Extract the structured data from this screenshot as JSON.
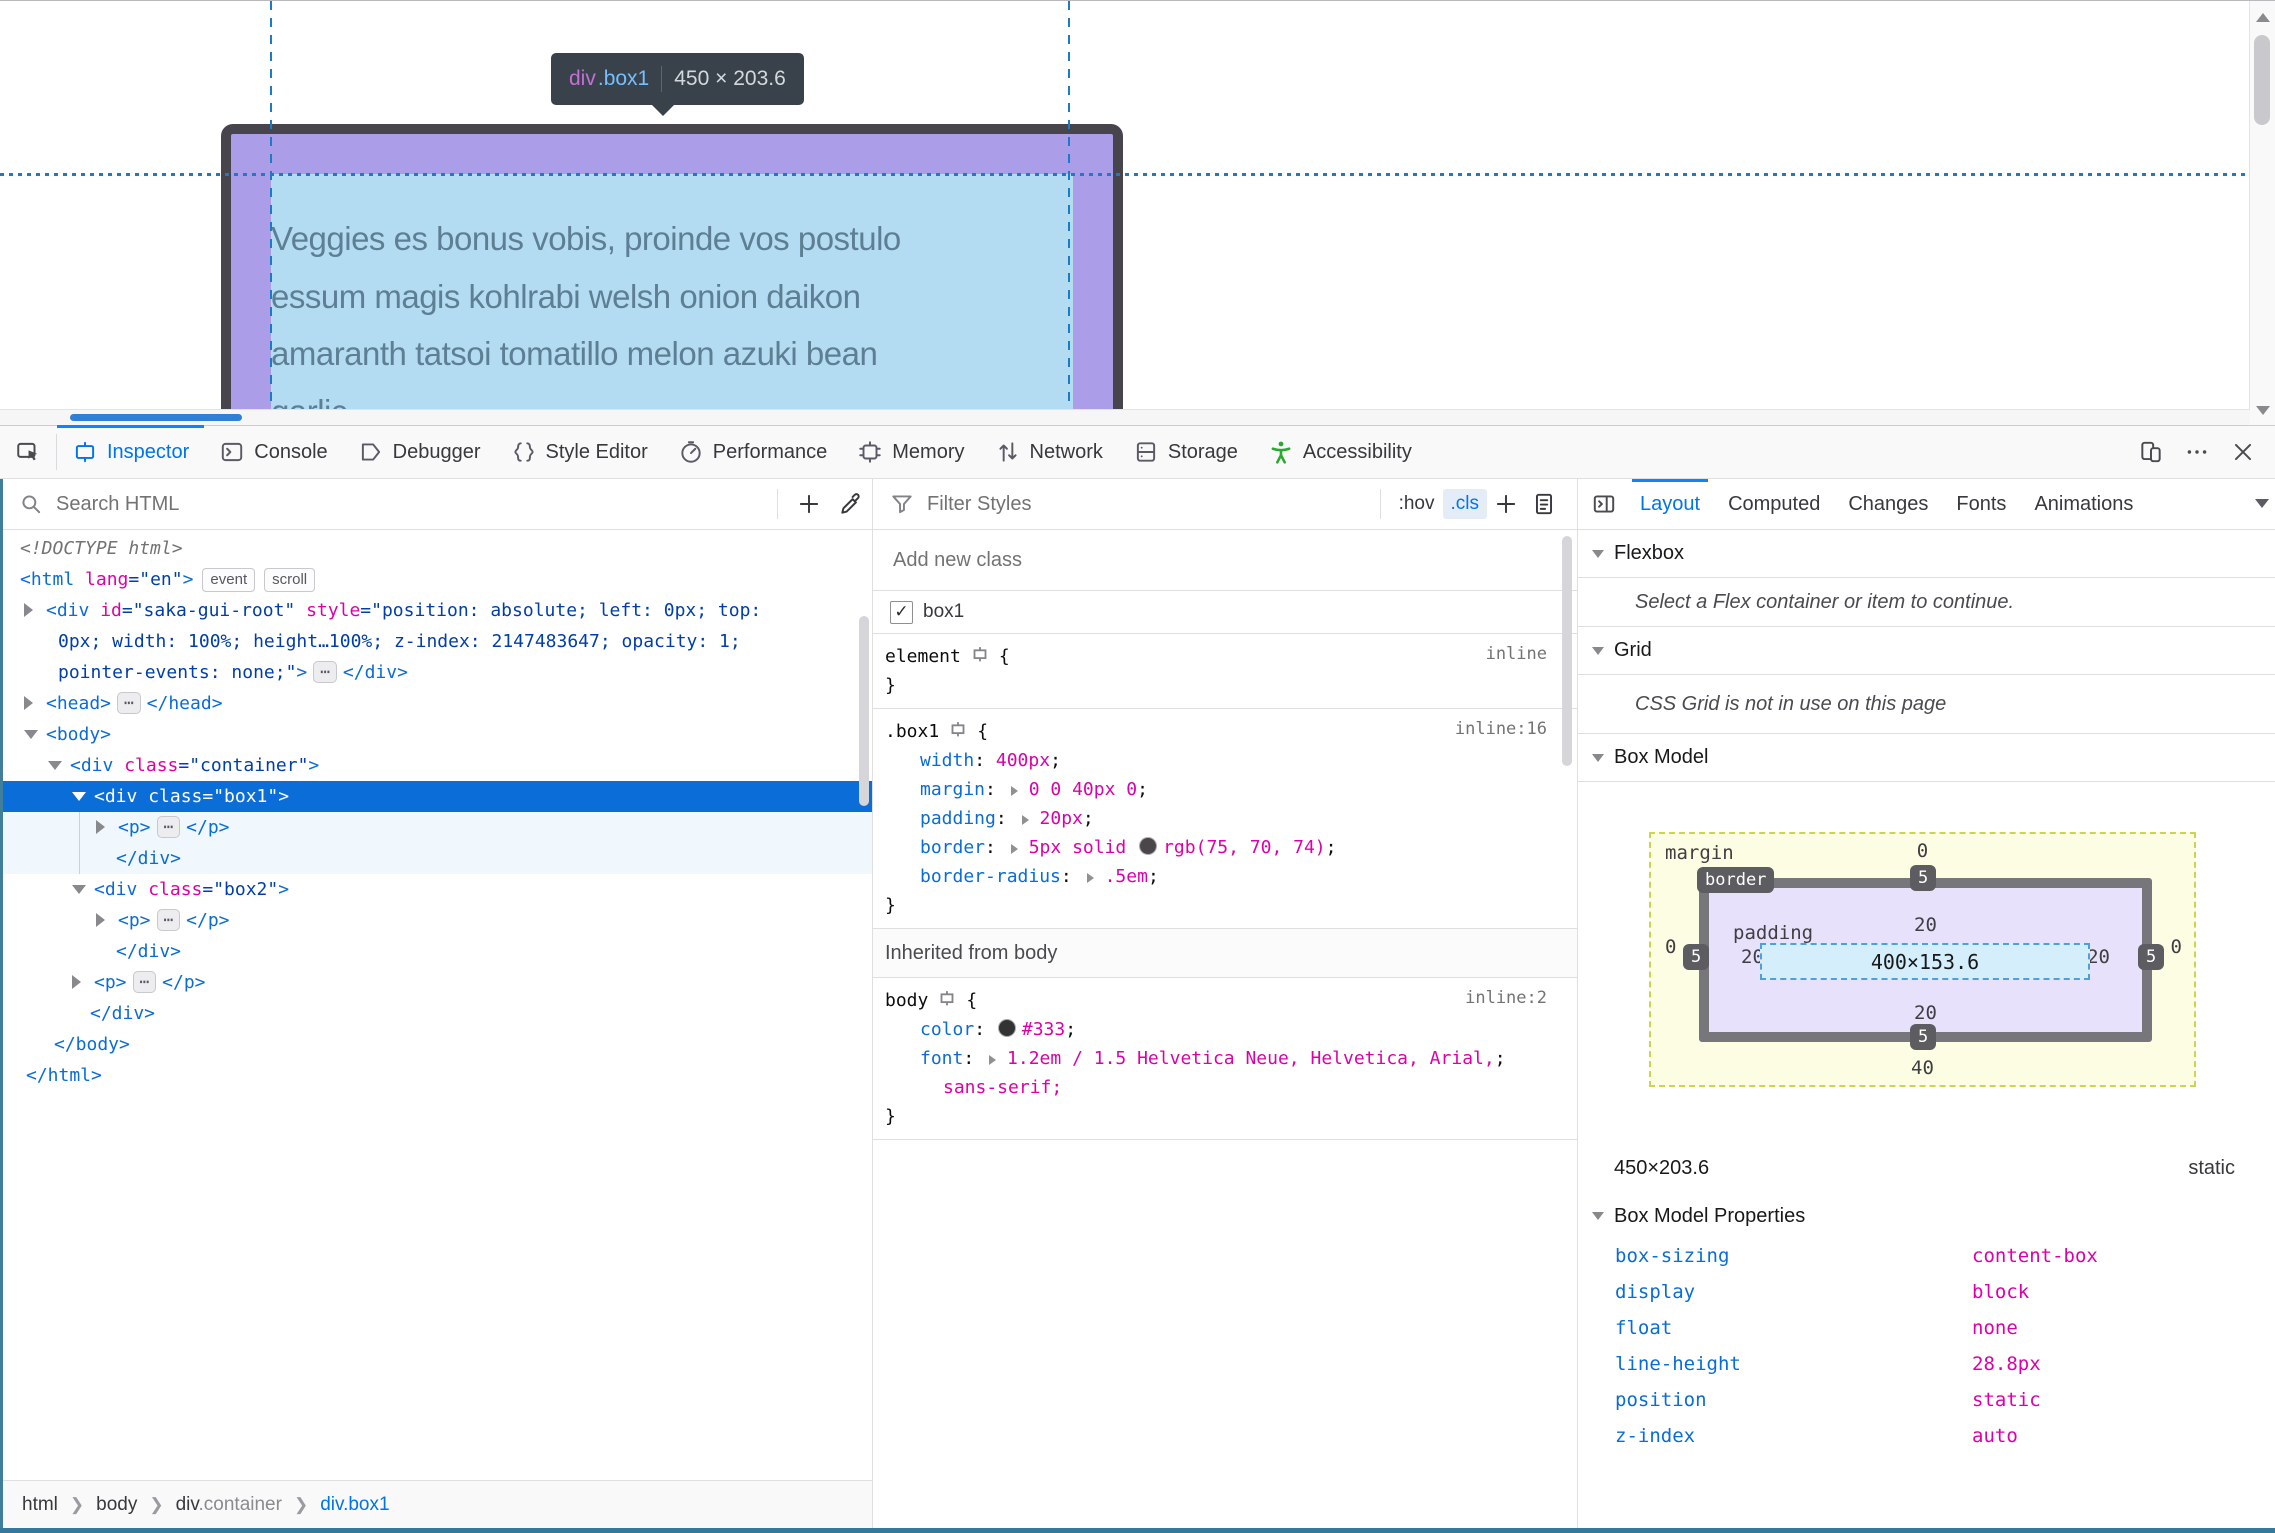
{
  "viewport": {
    "tooltip": {
      "tag": "div",
      "class": ".box1",
      "size": "450 × 203.6"
    },
    "page_text_lines": [
      "Veggies es bonus vobis, proinde vos postulo",
      "essum magis kohlrabi welsh onion daikon",
      "amaranth tatsoi tomatillo melon azuki bean",
      "garlic."
    ],
    "overlay_colors": {
      "border": "#47444b",
      "padding": "#ab9de8",
      "content": "#b3dcf2",
      "guide": "#1d7ac4"
    }
  },
  "toolbar": {
    "tabs": [
      {
        "icon": "inspector",
        "label": "Inspector",
        "active": true
      },
      {
        "icon": "console",
        "label": "Console"
      },
      {
        "icon": "debugger",
        "label": "Debugger"
      },
      {
        "icon": "style-editor",
        "label": "Style Editor"
      },
      {
        "icon": "performance",
        "label": "Performance"
      },
      {
        "icon": "memory",
        "label": "Memory"
      },
      {
        "icon": "network",
        "label": "Network"
      },
      {
        "icon": "storage",
        "label": "Storage"
      },
      {
        "icon": "accessibility",
        "label": "Accessibility",
        "green": true
      }
    ],
    "right_icons": [
      "responsive-mode",
      "meatball-menu",
      "close"
    ]
  },
  "markup": {
    "search_placeholder": "Search HTML",
    "rows": [
      {
        "indent": 20,
        "parts": [
          {
            "c": "doctype",
            "x": "<!DOCTYPE html>"
          }
        ]
      },
      {
        "indent": 20,
        "parts": [
          {
            "c": "tag",
            "x": "<html "
          },
          {
            "c": "attr",
            "x": "lang"
          },
          {
            "c": "val",
            "x": "=\"en\""
          },
          {
            "c": "tag",
            "x": ">"
          },
          {
            "badge": "event"
          },
          {
            "badge": "scroll"
          }
        ]
      },
      {
        "indent": 46,
        "arrow": "right",
        "parts": [
          {
            "c": "tag",
            "x": "<div "
          },
          {
            "c": "attr",
            "x": "id"
          },
          {
            "c": "val",
            "x": "=\"saka-gui-root\" "
          },
          {
            "c": "attr",
            "x": "style"
          },
          {
            "c": "val",
            "x": "=\"position: absolute; left: 0px; top:"
          }
        ]
      },
      {
        "indent": 58,
        "parts": [
          {
            "c": "val",
            "x": "0px; width: 100%; height…100%; z-index: 2147483647; opacity: 1;"
          }
        ]
      },
      {
        "indent": 58,
        "parts": [
          {
            "c": "val",
            "x": "pointer-events: none;\""
          },
          {
            "c": "tag",
            "x": ">"
          },
          {
            "ellipsis": true
          },
          {
            "c": "tag",
            "x": "</div>"
          }
        ]
      },
      {
        "indent": 46,
        "arrow": "right",
        "parts": [
          {
            "c": "tag",
            "x": "<head>"
          },
          {
            "ellipsis": true
          },
          {
            "c": "tag",
            "x": "</head>"
          }
        ]
      },
      {
        "indent": 46,
        "arrow": "down",
        "parts": [
          {
            "c": "tag",
            "x": "<body>"
          }
        ]
      },
      {
        "indent": 70,
        "arrow": "down",
        "parts": [
          {
            "c": "tag",
            "x": "<div "
          },
          {
            "c": "attr",
            "x": "class"
          },
          {
            "c": "val",
            "x": "=\"container\""
          },
          {
            "c": "tag",
            "x": ">"
          }
        ]
      },
      {
        "indent": 94,
        "arrow": "down",
        "selected": true,
        "parts": [
          {
            "c": "tag",
            "x": "<div "
          },
          {
            "c": "attr",
            "x": "class"
          },
          {
            "c": "val",
            "x": "=\"box1\""
          },
          {
            "c": "tag",
            "x": ">"
          }
        ]
      },
      {
        "indent": 118,
        "arrow": "right",
        "tinted": true,
        "parts": [
          {
            "c": "tag",
            "x": "<p>"
          },
          {
            "ellipsis": true
          },
          {
            "c": "tag",
            "x": "</p>"
          }
        ]
      },
      {
        "indent": 116,
        "tinted": true,
        "parts": [
          {
            "c": "tag",
            "x": "</div>"
          }
        ]
      },
      {
        "indent": 94,
        "arrow": "down",
        "parts": [
          {
            "c": "tag",
            "x": "<div "
          },
          {
            "c": "attr",
            "x": "class"
          },
          {
            "c": "val",
            "x": "=\"box2\""
          },
          {
            "c": "tag",
            "x": ">"
          }
        ]
      },
      {
        "indent": 118,
        "arrow": "right",
        "parts": [
          {
            "c": "tag",
            "x": "<p>"
          },
          {
            "ellipsis": true
          },
          {
            "c": "tag",
            "x": "</p>"
          }
        ]
      },
      {
        "indent": 116,
        "parts": [
          {
            "c": "tag",
            "x": "</div>"
          }
        ]
      },
      {
        "indent": 94,
        "arrow": "right",
        "parts": [
          {
            "c": "tag",
            "x": "<p>"
          },
          {
            "ellipsis": true
          },
          {
            "c": "tag",
            "x": "</p>"
          }
        ]
      },
      {
        "indent": 90,
        "parts": [
          {
            "c": "tag",
            "x": "</div>"
          }
        ]
      },
      {
        "indent": 54,
        "parts": [
          {
            "c": "tag",
            "x": "</body>"
          }
        ]
      },
      {
        "indent": 26,
        "parts": [
          {
            "c": "tag",
            "x": "</html>"
          }
        ]
      }
    ]
  },
  "rules": {
    "filter_placeholder": "Filter Styles",
    "hov_label": ":hov",
    "cls_label": ".cls",
    "add_class_placeholder": "Add new class",
    "class_items": [
      {
        "label": "box1",
        "checked": true
      }
    ],
    "rule_blocks": [
      {
        "selector": "element",
        "link": "inline",
        "decls": []
      },
      {
        "selector": ".box1",
        "link": "inline:16",
        "decls": [
          {
            "name": "width",
            "value": "400px"
          },
          {
            "name": "margin",
            "expand": true,
            "value": "0 0 40px 0"
          },
          {
            "name": "padding",
            "expand": true,
            "value": "20px"
          },
          {
            "name": "border",
            "expand": true,
            "pre": "5px solid ",
            "swatch": "#4b464a",
            "value": "rgb(75, 70, 74)"
          },
          {
            "name": "border-radius",
            "expand": true,
            "value": ".5em"
          }
        ]
      }
    ],
    "inherited_header": "Inherited from body",
    "inherited_rule": {
      "selector": "body",
      "link": "inline:2",
      "decls": [
        {
          "name": "color",
          "swatch": "#333333",
          "value": "#333"
        },
        {
          "name": "font",
          "expand": true,
          "value": "1.2em / 1.5 Helvetica Neue, Helvetica, Arial,",
          "wrap": "sans-serif;"
        }
      ]
    }
  },
  "layout_panel": {
    "tabs": [
      {
        "label": "Layout",
        "active": true
      },
      {
        "label": "Computed"
      },
      {
        "label": "Changes"
      },
      {
        "label": "Fonts"
      },
      {
        "label": "Animations"
      }
    ],
    "flexbox": {
      "header": "Flexbox",
      "message": "Select a Flex container or item to continue."
    },
    "grid": {
      "header": "Grid",
      "message": "CSS Grid is not in use on this page"
    },
    "box_model": {
      "header": "Box Model",
      "labels": {
        "margin": "margin",
        "border": "border",
        "padding": "padding"
      },
      "margin": {
        "top": "0",
        "right": "0",
        "bottom": "40",
        "left": "0"
      },
      "border": {
        "top": "5",
        "right": "5",
        "bottom": "5",
        "left": "5"
      },
      "padding": {
        "top": "20",
        "right": "20",
        "bottom": "20",
        "left": "20"
      },
      "content": "400×153.6",
      "size": "450×203.6",
      "position": "static"
    },
    "bmp_header": "Box Model Properties",
    "bmp_rows": [
      {
        "name": "box-sizing",
        "value": "content-box"
      },
      {
        "name": "display",
        "value": "block"
      },
      {
        "name": "float",
        "value": "none"
      },
      {
        "name": "line-height",
        "value": "28.8px"
      },
      {
        "name": "position",
        "value": "static"
      },
      {
        "name": "z-index",
        "value": "auto"
      }
    ]
  },
  "breadcrumbs": [
    {
      "label": "html"
    },
    {
      "label": "body"
    },
    {
      "label": "div",
      "suffix": ".container"
    },
    {
      "label": "div.box1",
      "active": true
    }
  ]
}
